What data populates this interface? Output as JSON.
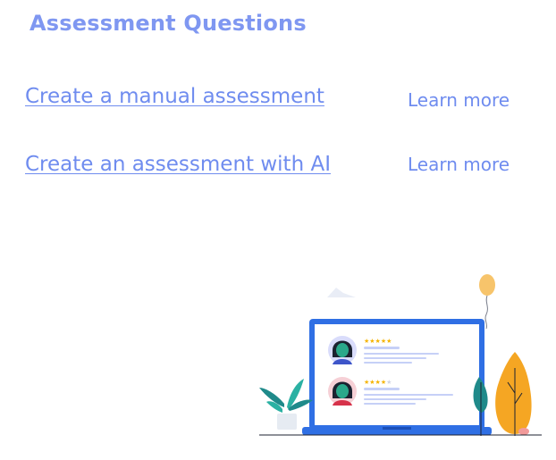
{
  "section": {
    "title": "Assessment Questions"
  },
  "options": [
    {
      "link_label": "Create a manual assessment",
      "learn_label": "Learn more"
    },
    {
      "link_label": "Create an assessment with AI",
      "learn_label": "Learn more"
    }
  ],
  "illustration": {
    "cards": [
      {
        "stars_filled": 5,
        "stars_total": 5
      },
      {
        "stars_filled": 4,
        "stars_total": 5
      }
    ],
    "colors": {
      "accent": "#7f97f1",
      "laptop": "#2f6fe4",
      "star": "#f5b400",
      "tree": "#f5a623",
      "plant": "#1f8a8a",
      "balloon": "#f7c46b"
    }
  }
}
